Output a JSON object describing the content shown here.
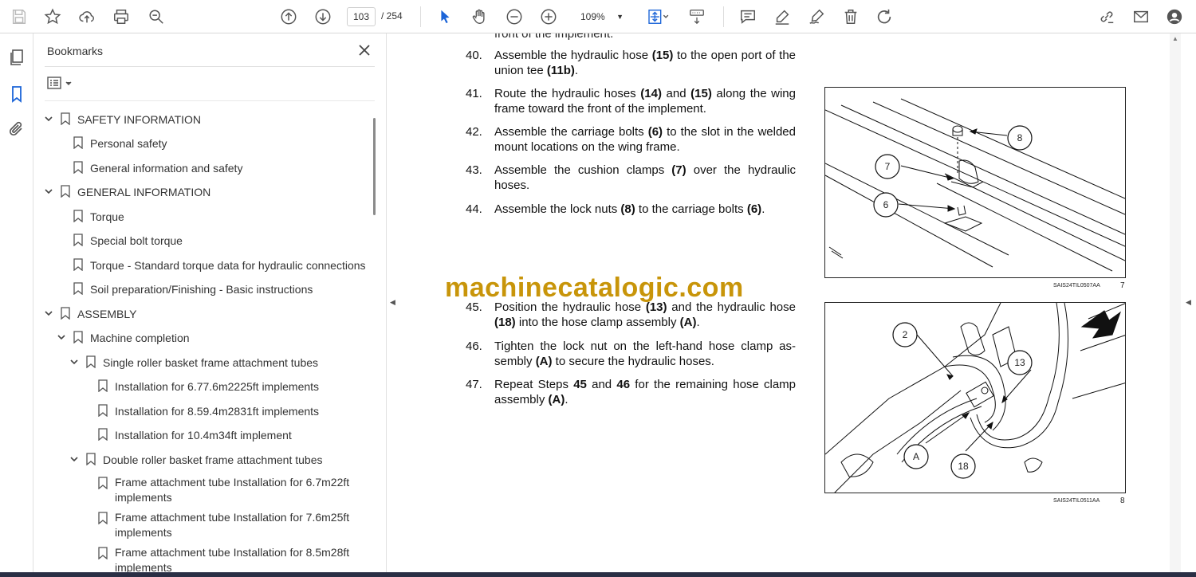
{
  "toolbar": {
    "page_current": "103",
    "page_total": "/ 254",
    "zoom": "109%"
  },
  "bookmarks": {
    "title": "Bookmarks",
    "items": [
      {
        "label": "SAFETY INFORMATION",
        "expanded": true
      },
      {
        "label": "Personal safety"
      },
      {
        "label": "General information and safety"
      },
      {
        "label": "GENERAL INFORMATION",
        "expanded": true
      },
      {
        "label": "Torque"
      },
      {
        "label": "Special bolt torque"
      },
      {
        "label": "Torque - Standard torque data for hydraulic connections"
      },
      {
        "label": "Soil preparation/Finishing - Basic instructions"
      },
      {
        "label": "ASSEMBLY",
        "expanded": true
      },
      {
        "label": "Machine completion",
        "expanded": true
      },
      {
        "label": "Single roller basket frame attachment tubes",
        "expanded": true
      },
      {
        "label": "Installation for 6.77.6m2225ft implements"
      },
      {
        "label": "Installation for 8.59.4m2831ft implements"
      },
      {
        "label": "Installation for 10.4m34ft implement"
      },
      {
        "label": "Double roller basket frame attachment tubes",
        "expanded": true
      },
      {
        "label": "Frame attachment tube Installation for 6.7m22ft implements"
      },
      {
        "label": "Frame attachment tube Installation for 7.6m25ft implements"
      },
      {
        "label": "Frame attachment tube Installation for 8.5m28ft implements"
      }
    ]
  },
  "document": {
    "cut_line": "front of the implement.",
    "steps": [
      {
        "num": "40.",
        "html": "Assemble the hydraulic hose <b>(15)</b> to the open port of the union tee <b>(11b)</b>."
      },
      {
        "num": "41.",
        "html": "Route the hydraulic hoses <b>(14)</b> and <b>(15)</b> along the wing frame toward the front of the implement."
      },
      {
        "num": "42.",
        "html": "Assemble the carriage bolts <b>(6)</b> to the slot in the welded mount locations on the wing frame."
      },
      {
        "num": "43.",
        "html": "Assemble the cushion clamps <b>(7)</b> over the hydraulic hoses."
      },
      {
        "num": "44.",
        "html": "Assemble the lock nuts <b>(8)</b> to the carriage bolts <b>(6)</b>."
      },
      {
        "num": "45.",
        "html": "Position the hydraulic hose <b>(13)</b> and the hydraulic hose <b>(18)</b> into the hose clamp assembly <b>(A)</b>."
      },
      {
        "num": "46.",
        "html": "Tighten the lock nut on the left-hand hose clamp as-sembly <b>(A)</b> to secure the hydraulic hoses."
      },
      {
        "num": "47.",
        "html": "Repeat Steps <b>45</b> and <b>46</b> for the remaining hose clamp assembly <b>(A)</b>."
      }
    ],
    "figures": [
      {
        "caption": "SAIS24TIL0507AA",
        "number": "7",
        "callouts": [
          "8",
          "7",
          "6"
        ]
      },
      {
        "caption": "SAIS24TIL0511AA",
        "number": "8",
        "callouts": [
          "2",
          "13",
          "A",
          "18"
        ]
      }
    ],
    "watermark": "machinecatalogic.com"
  }
}
